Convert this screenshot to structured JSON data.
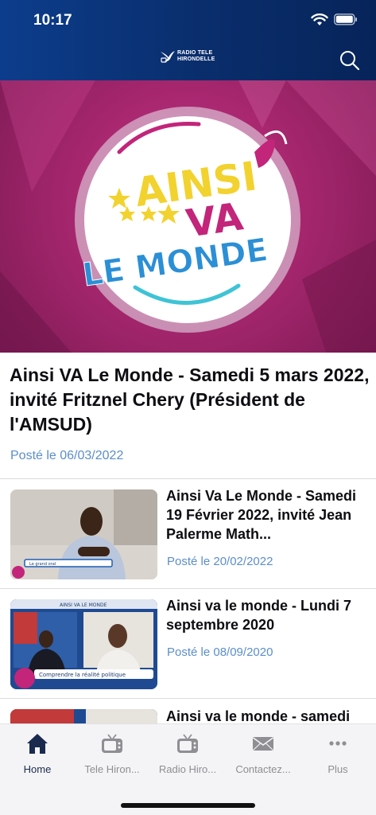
{
  "status": {
    "time": "10:17"
  },
  "header": {
    "logo_line1": "RADIO TELE",
    "logo_line2": "HIRONDELLE",
    "search_icon": "search-icon"
  },
  "featured": {
    "hero_text_line1": "AINSI",
    "hero_text_line2": "VA",
    "hero_text_line3": "LE MONDE",
    "title": "Ainsi VA Le Monde - Samedi 5 mars 2022, invité Fritznel Chery (Président de l'AMSUD)",
    "date": "Posté le 06/03/2022"
  },
  "items": [
    {
      "title": "Ainsi Va Le Monde - Samedi 19 Février 2022, invité Jean Palerme Math...",
      "date": "Posté le 20/02/2022",
      "thumb_caption": "Le grand oral"
    },
    {
      "title": "Ainsi va le monde - Lundi 7 septembre 2020",
      "date": "Posté le 08/09/2020",
      "thumb_header": "AINSI VA LE MONDE",
      "thumb_caption": "Comprendre la réalité politique"
    },
    {
      "title": "Ainsi va le monde - samedi",
      "date": ""
    }
  ],
  "tabs": [
    {
      "label": "Home",
      "icon": "home-icon",
      "active": true
    },
    {
      "label": "Tele Hiron...",
      "icon": "tv-icon",
      "active": false
    },
    {
      "label": "Radio Hiro...",
      "icon": "radio-icon",
      "active": false
    },
    {
      "label": "Contactez...",
      "icon": "mail-icon",
      "active": false
    },
    {
      "label": "Plus",
      "icon": "more-icon",
      "active": false
    }
  ],
  "colors": {
    "header_blue": "#0a2f6e",
    "accent_blue": "#5b8ec9",
    "hero_pink": "#a8276f"
  }
}
